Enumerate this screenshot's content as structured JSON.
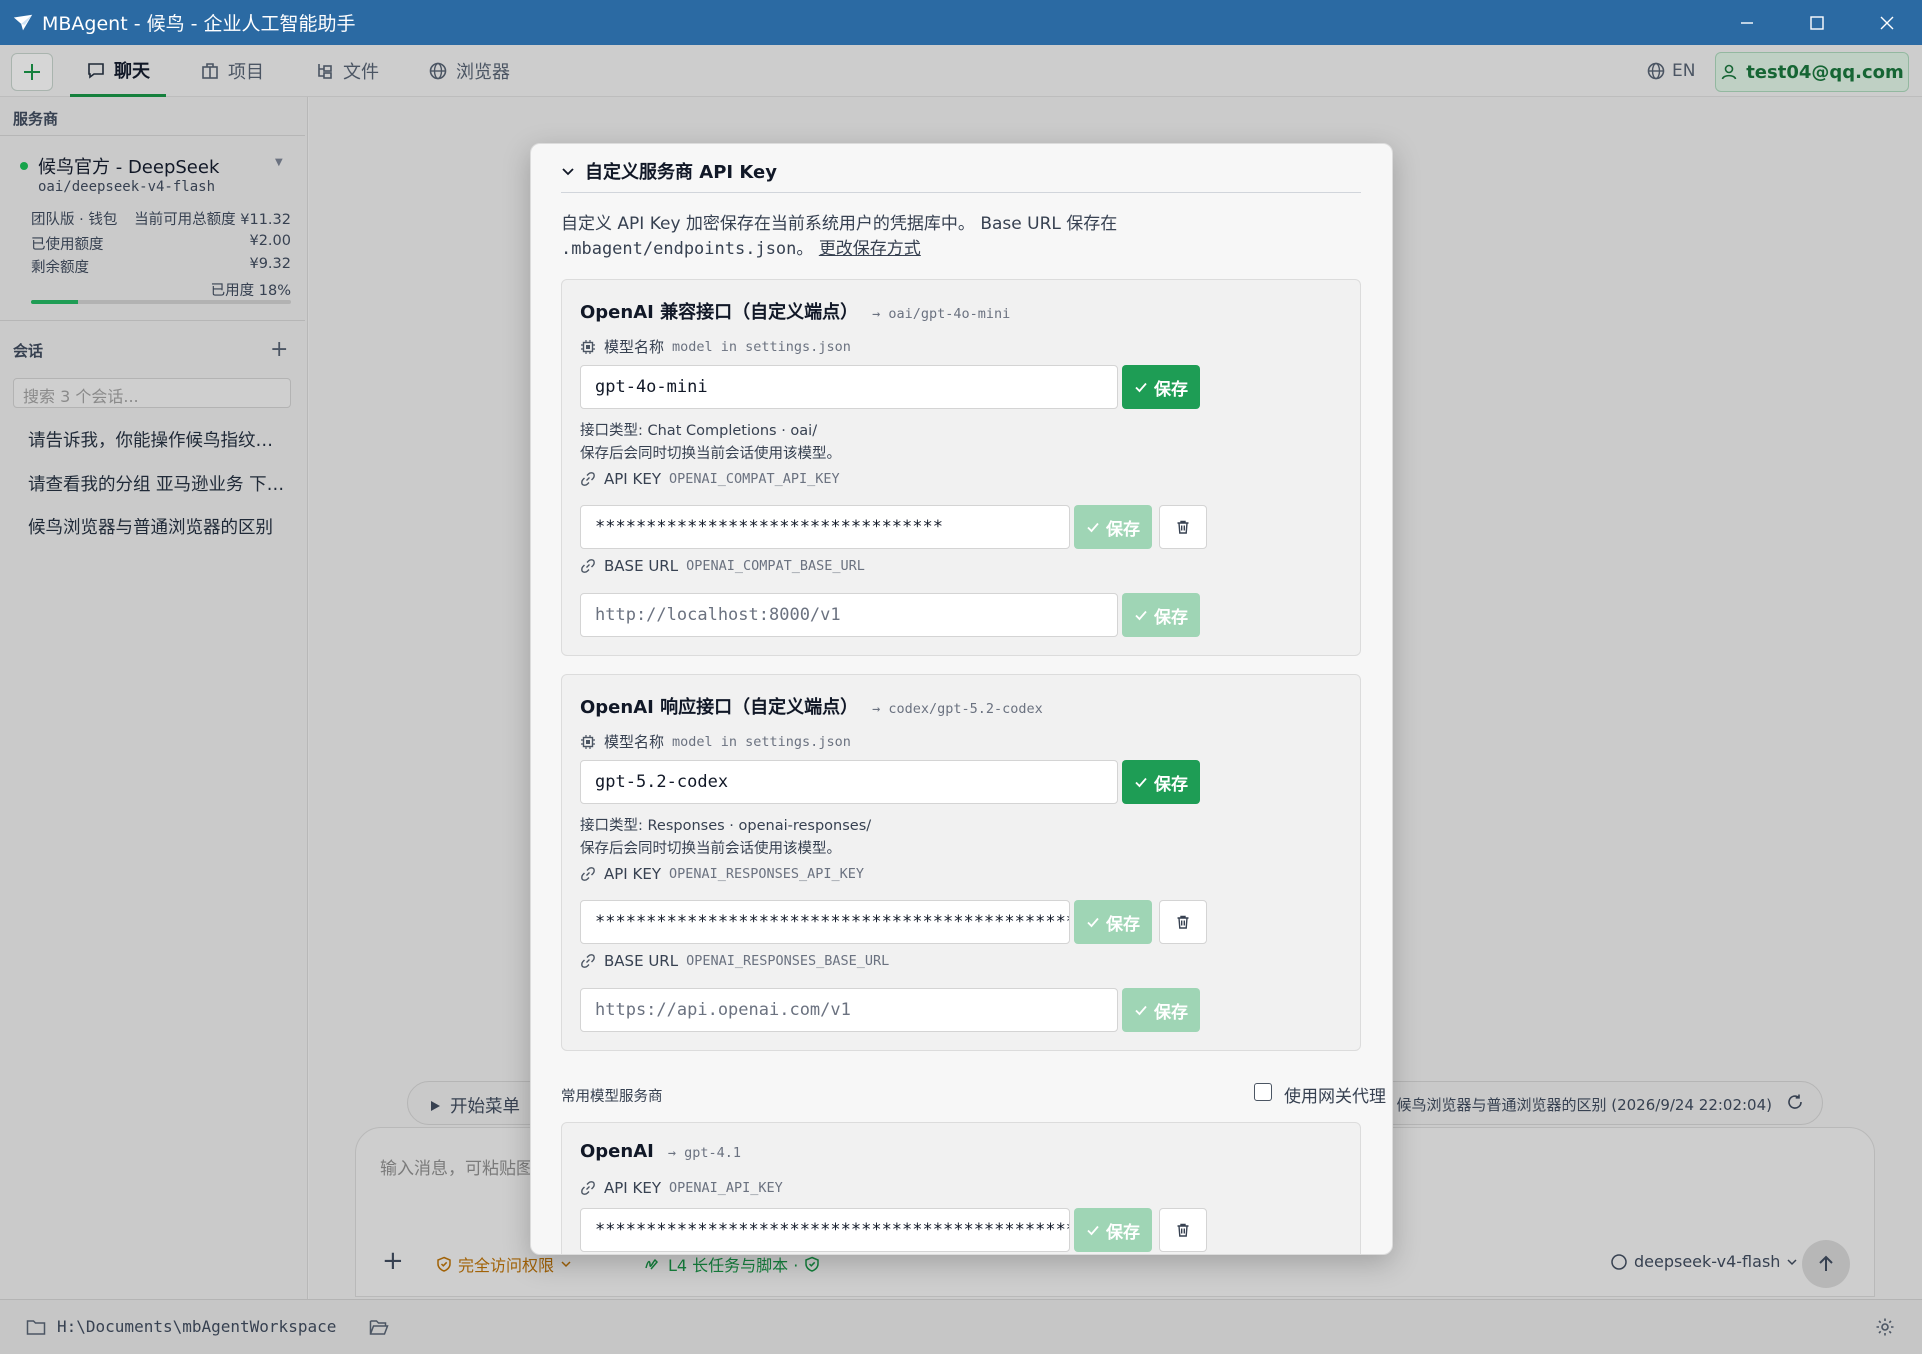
{
  "window": {
    "title": "MBAgent - 候鸟 - 企业人工智能助手"
  },
  "nav": {
    "tabs": [
      {
        "label": "聊天",
        "icon": "chat-icon"
      },
      {
        "label": "项目",
        "icon": "briefcase-icon"
      },
      {
        "label": "文件",
        "icon": "folder-tree-icon"
      },
      {
        "label": "浏览器",
        "icon": "globe-icon"
      }
    ],
    "active_tab": "聊天",
    "lang": "EN",
    "user": "test04@qq.com"
  },
  "sidebar": {
    "provider_heading": "服务商",
    "provider": {
      "name": "候鸟官方 - DeepSeek",
      "model": "oai/deepseek-v4-flash"
    },
    "wallet": {
      "plan": "团队版 · 钱包",
      "available": "当前可用总额度 ¥11.32",
      "used_label": "已使用额度",
      "used_value": "¥2.00",
      "remaining_label": "剩余额度",
      "remaining_value": "¥9.32",
      "usage_text": "已用度 18%",
      "usage_fraction": 0.18
    },
    "conversations_heading": "会话",
    "search_placeholder": "搜索 3 个会话...",
    "conversations": [
      "请告诉我，你能操作候鸟指纹浏览器吗",
      "请查看我的分组 亚马逊业务 下的环境",
      "候鸟浏览器与普通浏览器的区别"
    ]
  },
  "main": {
    "start_menu": "开始菜单",
    "task_text": "任务: 候鸟浏览器与普通浏览器的区别 (2026/9/24 22:02:04)",
    "composer_placeholder": "输入消息，可粘贴图片...",
    "permission": "完全访问权限",
    "l4_mode": "L4 长任务与脚本 ·",
    "model": "deepseek-v4-flash"
  },
  "statusbar": {
    "workspace_path": "H:\\Documents\\mbAgentWorkspace"
  },
  "modal": {
    "header": "自定义服务商 API Key",
    "desc_line1": "自定义 API Key 加密保存在当前系统用户的凭据库中。 Base URL 保存在",
    "desc_line2": ".mbagent/endpoints.json。",
    "desc_link": "更改保存方式",
    "labels": {
      "model_name": "模型名称",
      "model_hint": "model in settings.json",
      "api_key": "API KEY",
      "base_url": "BASE URL",
      "save": "保存"
    },
    "cards": [
      {
        "title": "OpenAI 兼容接口（自定义端点）",
        "route": "→ oai/gpt-4o-mini",
        "model_value": "gpt-4o-mini",
        "interface_type": "接口类型: Chat Completions · oai/",
        "switch_note": "保存后会同时切换当前会话使用该模型。",
        "api_key_env": "OPENAI_COMPAT_API_KEY",
        "api_key_value": "**********************************",
        "base_url_env": "OPENAI_COMPAT_BASE_URL",
        "base_url_placeholder": "http://localhost:8000/v1"
      },
      {
        "title": "OpenAI 响应接口（自定义端点）",
        "route": "→ codex/gpt-5.2-codex",
        "model_value": "gpt-5.2-codex",
        "interface_type": "接口类型: Responses · openai-responses/",
        "switch_note": "保存后会同时切换当前会话使用该模型。",
        "api_key_env": "OPENAI_RESPONSES_API_KEY",
        "api_key_value": "**************************************************",
        "base_url_env": "OPENAI_RESPONSES_BASE_URL",
        "base_url_placeholder": "https://api.openai.com/v1"
      }
    ],
    "common_providers_heading": "常用模型服务商",
    "gateway_proxy_label": "使用网关代理",
    "openai_card": {
      "title": "OpenAI",
      "route": "→ gpt-4.1",
      "api_key_env": "OPENAI_API_KEY",
      "api_key_value": "************************************************************"
    }
  },
  "colors": {
    "accent": "#1e9d55",
    "title_bar": "#2b6aa3",
    "accent_faded": "#9fd5b5"
  }
}
